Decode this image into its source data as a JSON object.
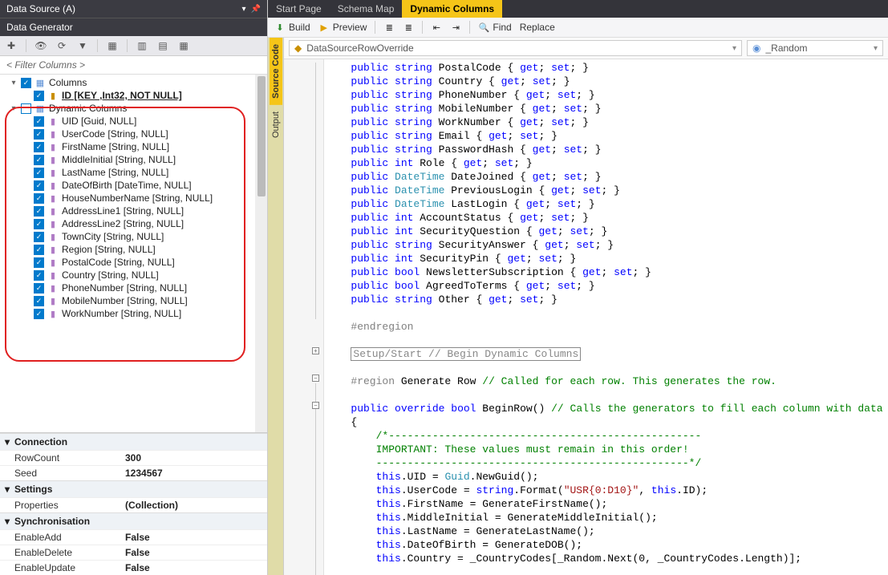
{
  "leftPanel": {
    "title": "Data Source (A)",
    "subtitle": "Data Generator",
    "filterPlaceholder": "< Filter Columns >",
    "tree": {
      "columnsLabel": "Columns",
      "idLabel": "ID [KEY ,Int32, NOT NULL]",
      "dynamicLabel": "Dynamic Columns",
      "items": [
        "UID [Guid, NULL]",
        "UserCode [String, NULL]",
        "FirstName [String, NULL]",
        "MiddleInitial [String, NULL]",
        "LastName [String, NULL]",
        "DateOfBirth [DateTime, NULL]",
        "HouseNumberName [String, NULL]",
        "AddressLine1 [String, NULL]",
        "AddressLine2 [String, NULL]",
        "TownCity [String, NULL]",
        "Region [String, NULL]",
        "PostalCode [String, NULL]",
        "Country [String, NULL]",
        "PhoneNumber [String, NULL]",
        "MobileNumber [String, NULL]",
        "WorkNumber [String, NULL]"
      ]
    },
    "props": {
      "secConnection": "Connection",
      "rowCountKey": "RowCount",
      "rowCountVal": "300",
      "seedKey": "Seed",
      "seedVal": "1234567",
      "secSettings": "Settings",
      "propertiesKey": "Properties",
      "propertiesVal": "(Collection)",
      "secSync": "Synchronisation",
      "enableAddKey": "EnableAdd",
      "enableAddVal": "False",
      "enableDeleteKey": "EnableDelete",
      "enableDeleteVal": "False",
      "enableUpdateKey": "EnableUpdate",
      "enableUpdateVal": "False"
    }
  },
  "rightPanel": {
    "tabs": {
      "start": "Start Page",
      "schema": "Schema Map",
      "dynamic": "Dynamic Columns"
    },
    "toolbar": {
      "build": "Build",
      "preview": "Preview",
      "find": "Find",
      "replace": "Replace"
    },
    "dropdowns": {
      "override": "DataSourceRowOverride",
      "random": "_Random"
    },
    "vtabs": {
      "source": "Source Code",
      "output": "Output"
    },
    "collapsedRegion": "Setup/Start // Begin Dynamic Columns"
  }
}
